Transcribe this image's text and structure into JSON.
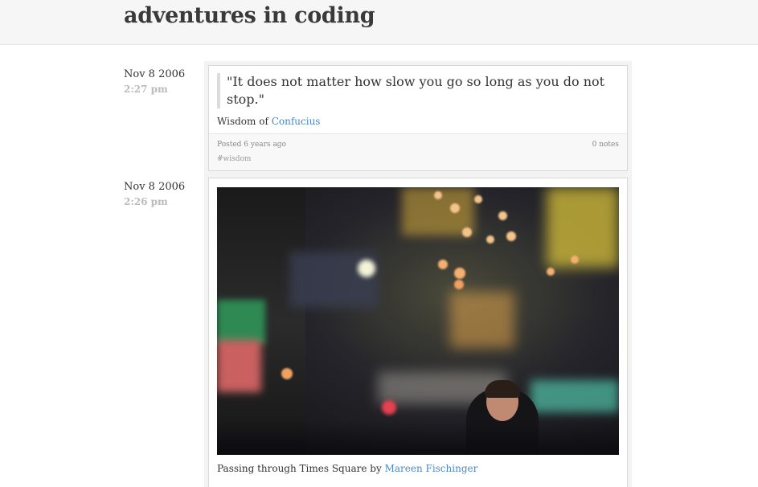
{
  "site": {
    "title": "adventures in coding"
  },
  "posts": [
    {
      "date": "Nov 8 2006",
      "time": "2:27 pm",
      "quote": "\"It does not matter how slow you go so long as you do not stop.\"",
      "source_prefix": "Wisdom of",
      "source_link": "Confucius",
      "posted": "Posted 6 years ago",
      "notes": "0 notes",
      "tag": "#wisdom"
    },
    {
      "date": "Nov 8 2006",
      "time": "2:26 pm",
      "photo_alt": "Times Square bokeh",
      "caption_prefix": "Passing through Times Square by",
      "caption_link": "Mareen Fischinger"
    }
  ]
}
